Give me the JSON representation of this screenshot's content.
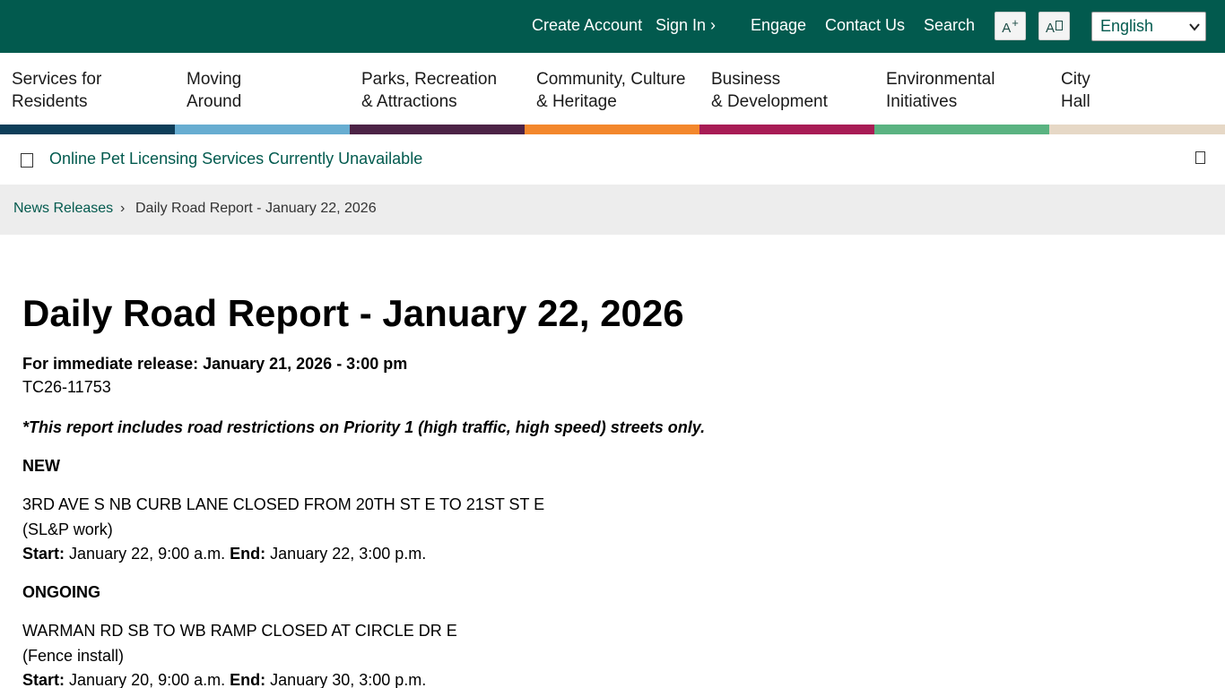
{
  "topbar": {
    "links": [
      "Create Account",
      "Sign In ›",
      "Engage",
      "Contact Us",
      "Search"
    ],
    "font_increase_label": "A",
    "font_increase_sup": "+",
    "font_toggle_label": "A",
    "language": "English"
  },
  "nav": {
    "items": [
      {
        "line1": "Services for",
        "line2": "Residents",
        "color": "#0e3e59"
      },
      {
        "line1": "Moving",
        "line2": "Around",
        "color": "#67add1"
      },
      {
        "line1": "Parks, Recreation",
        "line2": "& Attractions",
        "color": "#4c2346"
      },
      {
        "line1": "Community, Culture",
        "line2": "& Heritage",
        "color": "#f3872c"
      },
      {
        "line1": "Business",
        "line2": "& Development",
        "color": "#a81c55"
      },
      {
        "line1": "Environmental",
        "line2": "Initiatives",
        "color": "#5ab381"
      },
      {
        "line1": "City",
        "line2": "Hall",
        "color": "#e6d8c6"
      }
    ]
  },
  "alert": {
    "text": "Online Pet Licensing Services Currently Unavailable"
  },
  "breadcrumb": {
    "parent": "News Releases",
    "separator": "›",
    "current": "Daily Road Report - January 22, 2026"
  },
  "article": {
    "title": "Daily Road Report - January 22, 2026",
    "release": "For immediate release: January 21, 2026 - 3:00 pm",
    "code": "TC26-11753",
    "note": "*This report includes road restrictions on Priority 1 (high traffic, high speed) streets only.",
    "sections": [
      {
        "heading": "NEW",
        "entries": [
          {
            "road": "3RD AVE S NB CURB LANE CLOSED FROM 20TH ST E TO 21ST ST E",
            "reason": "(SL&P work)",
            "start_label": "Start:",
            "start": "January 22, 9:00 a.m.",
            "end_label": "End:",
            "end": "January 22, 3:00 p.m."
          }
        ]
      },
      {
        "heading": "ONGOING",
        "entries": [
          {
            "road": "WARMAN RD SB TO WB RAMP CLOSED AT CIRCLE DR E",
            "reason": "(Fence install)",
            "start_label": "Start:",
            "start": "January 20, 9:00 a.m.",
            "end_label": "End:",
            "end": "January 30, 3:00 p.m."
          }
        ]
      }
    ]
  },
  "colors": {
    "header_bg": "#025a4e",
    "link": "#025a4e",
    "breadcrumb_bg": "#ededed"
  }
}
